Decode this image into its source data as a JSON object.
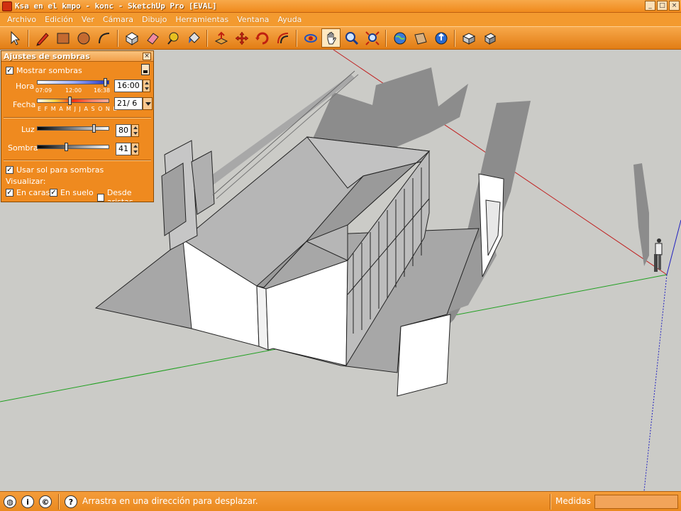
{
  "window": {
    "title": "Ksa en el kmpo - konc - SketchUp Pro [EVAL]",
    "controls": [
      "_",
      "□",
      "×"
    ]
  },
  "menu": [
    "Archivo",
    "Edición",
    "Ver",
    "Cámara",
    "Dibujo",
    "Herramientas",
    "Ventana",
    "Ayuda"
  ],
  "toolbar": {
    "tools": [
      {
        "name": "select",
        "icon": "arrow-select-icon"
      },
      {
        "name": "pencil",
        "icon": "pencil-icon"
      },
      {
        "name": "rectangle",
        "icon": "rectangle-icon"
      },
      {
        "name": "circle",
        "icon": "circle-icon"
      },
      {
        "name": "arc",
        "icon": "arc-icon"
      },
      {
        "name": "make-component",
        "icon": "component-icon"
      },
      {
        "name": "eraser",
        "icon": "eraser-icon"
      },
      {
        "name": "tape-measure",
        "icon": "tape-measure-icon"
      },
      {
        "name": "paint-bucket",
        "icon": "paint-bucket-icon"
      },
      {
        "name": "push-pull",
        "icon": "push-pull-icon"
      },
      {
        "name": "move",
        "icon": "move-icon"
      },
      {
        "name": "rotate",
        "icon": "rotate-icon"
      },
      {
        "name": "offset",
        "icon": "offset-icon"
      },
      {
        "name": "orbit",
        "icon": "orbit-icon"
      },
      {
        "name": "pan",
        "icon": "pan-hand-icon"
      },
      {
        "name": "zoom",
        "icon": "zoom-icon"
      },
      {
        "name": "zoom-extents",
        "icon": "zoom-extents-icon"
      },
      {
        "name": "get-models",
        "icon": "globe-icon"
      },
      {
        "name": "share-model",
        "icon": "share-model-icon"
      },
      {
        "name": "google-earth",
        "icon": "earth-icon"
      },
      {
        "name": "get-components",
        "icon": "get-components-icon"
      },
      {
        "name": "share-component",
        "icon": "share-component-icon"
      }
    ]
  },
  "shadow_dialog": {
    "title": "Ajustes de sombras",
    "show_shadows_label": "Mostrar sombras",
    "show_shadows_checked": true,
    "time_label": "Hora",
    "time_ticks": [
      "07:09",
      "12:00",
      "16:38"
    ],
    "time_value": "16:00",
    "date_label": "Fecha",
    "months": "E F M A M J J A S O N D",
    "date_value": "21/ 6",
    "light_label": "Luz",
    "light_value": "80",
    "dark_label": "Sombra",
    "dark_value": "41",
    "use_sun_label": "Usar sol para sombras",
    "use_sun_checked": true,
    "display_label": "Visualizar:",
    "on_faces_label": "En caras",
    "on_faces_checked": true,
    "on_ground_label": "En suelo",
    "on_ground_checked": true,
    "from_edges_label": "Desde aristas",
    "from_edges_checked": false
  },
  "statusbar": {
    "message": "Arrastra en una dirección para desplazar.",
    "measurements_label": "Medidas",
    "measurements_value": "",
    "icons": [
      "geo-location-icon",
      "credits-icon",
      "copyright-icon",
      "help-icon"
    ]
  },
  "colors": {
    "chrome": "#f08a1c",
    "viewport": "#cbcbc7",
    "red_axis": "#c02020",
    "green_axis": "#20a020",
    "blue_axis": "#2020c0"
  }
}
